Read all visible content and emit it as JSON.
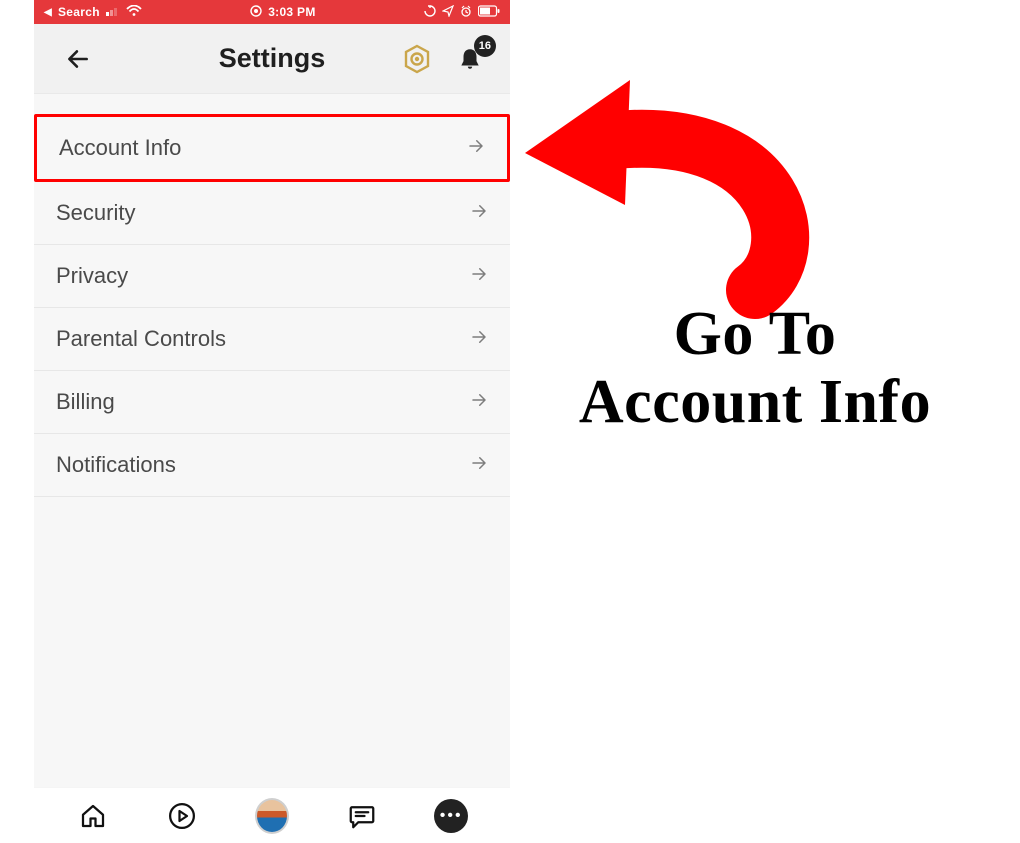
{
  "status_bar": {
    "back_app": "Search",
    "time": "3:03 PM"
  },
  "header": {
    "title": "Settings",
    "notification_count": "16"
  },
  "settings": {
    "items": [
      {
        "label": "Account Info",
        "highlight": true
      },
      {
        "label": "Security"
      },
      {
        "label": "Privacy"
      },
      {
        "label": "Parental Controls"
      },
      {
        "label": "Billing"
      },
      {
        "label": "Notifications"
      }
    ]
  },
  "annotation": {
    "line1": "Go To",
    "line2": "Account Info"
  }
}
